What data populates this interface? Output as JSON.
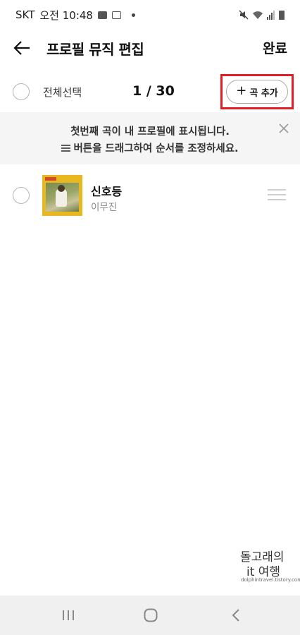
{
  "status_bar": {
    "carrier": "SKT",
    "time": "오전 10:48"
  },
  "header": {
    "title": "프로필 뮤직 편집",
    "done_label": "완료"
  },
  "selection": {
    "select_all_label": "전체선택",
    "count_text": "1 / 30",
    "add_button_label": "곡 추가"
  },
  "banner": {
    "line1": "첫번째 곡이 내 프로필에 표시됩니다.",
    "line2": "버튼을 드래그하여 순서를 조정하세요."
  },
  "tracks": [
    {
      "title": "신호등",
      "artist": "이무진"
    }
  ],
  "watermark": {
    "line1": "돌고래의",
    "line2": "it 여행",
    "url": "dolphintravel.tistory.com"
  },
  "colors": {
    "highlight_frame": "#e21d25",
    "banner_bg": "#f5f5f5",
    "nav_bg": "#f0f0f0",
    "album_bg": "#e8b820"
  },
  "icons": {
    "back": "arrow-left-icon",
    "close": "close-icon",
    "drag": "drag-handle-icon",
    "nav_recent": "recent-apps-icon",
    "nav_home": "home-icon",
    "nav_back": "back-chevron-icon"
  }
}
